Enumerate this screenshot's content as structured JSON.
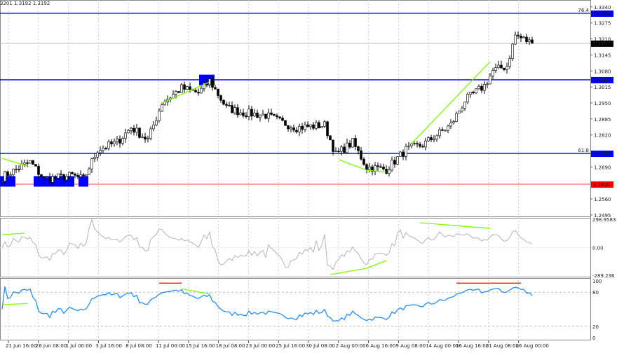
{
  "header": {
    "ohlc_text": "3201 1.3192 1.3192"
  },
  "colors": {
    "up": "#000000",
    "down": "#000000",
    "level_blue": "#0000ff",
    "level_red": "#ff4040",
    "green": "#7cfc00",
    "red": "#ff0000",
    "cci": "#b4b4b4",
    "rsi": "#1e90ff",
    "box": "#0000ff"
  },
  "chart_data": {
    "type": "candlestick",
    "price_axis": {
      "ticks": [
        "1.3340",
        "1.3275",
        "1.3210",
        "1.3145",
        "1.3080",
        "1.3015",
        "1.2950",
        "1.2885",
        "1.2820",
        "1.2690",
        "1.2560",
        "1.2495"
      ],
      "range": [
        1.2495,
        1.334
      ]
    },
    "current_price": {
      "label": "1.3192",
      "value": 1.3192
    },
    "levels": [
      {
        "label": "1.3314",
        "value": 1.3314,
        "color": "blue",
        "fib": "76.4"
      },
      {
        "label": "1.3044",
        "value": 1.3044,
        "color": "blue",
        "fib": ""
      },
      {
        "label": "1.2745",
        "value": 1.2745,
        "color": "blue",
        "fib": "61.8"
      },
      {
        "label": "1.2620",
        "value": 1.262,
        "color": "red",
        "fib": ""
      }
    ],
    "x_labels": [
      "21 Jun 16:00",
      "26 Jun 08:00",
      "1 Jul 00:00",
      "3 Jul 16:00",
      "8 Jul 08:00",
      "11 Jul 00:00",
      "15 Jul 16:00",
      "18 Jul 08:00",
      "23 Jul 00:00",
      "25 Jul 16:00",
      "30 Jul 08:00",
      "2 Aug 00:00",
      "6 Aug 16:00",
      "9 Aug 08:00",
      "14 Aug 00:00",
      "16 Aug 16:00",
      "21 Aug 08:00",
      "26 Aug 00:00"
    ],
    "price_path_bar_close": [
      [
        0,
        1.265
      ],
      [
        10,
        1.271
      ],
      [
        15,
        1.264
      ],
      [
        25,
        1.2655
      ],
      [
        29,
        1.264
      ],
      [
        34,
        1.276
      ],
      [
        41,
        1.279
      ],
      [
        46,
        1.285
      ],
      [
        52,
        1.28
      ],
      [
        57,
        1.295
      ],
      [
        64,
        1.301
      ],
      [
        70,
        1.299
      ],
      [
        74,
        1.304
      ],
      [
        80,
        1.293
      ],
      [
        86,
        1.291
      ],
      [
        94,
        1.29
      ],
      [
        100,
        1.287
      ],
      [
        105,
        1.285
      ],
      [
        115,
        1.286
      ],
      [
        119,
        1.274
      ],
      [
        125,
        1.279
      ],
      [
        130,
        1.269
      ],
      [
        137,
        1.268
      ],
      [
        144,
        1.276
      ],
      [
        150,
        1.278
      ],
      [
        160,
        1.286
      ],
      [
        165,
        1.296
      ],
      [
        172,
        1.302
      ],
      [
        175,
        1.308
      ],
      [
        180,
        1.31
      ],
      [
        183,
        1.3225
      ],
      [
        189,
        1.3192
      ]
    ],
    "boxes": [
      {
        "bars": [
          0,
          4
        ],
        "price": 1.263
      },
      {
        "bars": [
          12,
          25
        ],
        "price": 1.263
      },
      {
        "bars": [
          28,
          30
        ],
        "price": 1.263
      },
      {
        "bars": [
          71,
          75
        ],
        "price": 1.3042
      }
    ],
    "price_trendlines": [
      [
        [
          0,
          1.2725
        ],
        [
          9,
          1.2694
        ]
      ],
      [
        [
          57,
          1.295
        ],
        [
          74,
          1.3035
        ]
      ],
      [
        [
          120,
          1.272
        ],
        [
          130,
          1.2677
        ],
        [
          137,
          1.2669
        ]
      ],
      [
        [
          146,
          1.2785
        ],
        [
          174,
          1.3118
        ]
      ]
    ],
    "cci": {
      "name": "CCI",
      "top_label": "298.9583",
      "zero_label": "0.00",
      "bottom_label": "-289.236",
      "range": [
        -289.236,
        298.9583
      ],
      "trendlines": [
        [
          [
            0,
            137
          ],
          [
            8,
            152
          ]
        ],
        [
          [
            117,
            -282
          ],
          [
            130,
            -216
          ],
          [
            137,
            -135
          ]
        ],
        [
          [
            149,
            262
          ],
          [
            174,
            203
          ]
        ]
      ]
    },
    "rsi": {
      "name": "RSI",
      "labels": [
        "100",
        "80",
        "20",
        "0"
      ],
      "range": [
        0,
        100
      ],
      "levels": [
        80,
        20
      ],
      "green_lines": [
        [
          [
            0,
            58
          ],
          [
            9,
            60
          ]
        ],
        [
          [
            64,
            86
          ],
          [
            74,
            77
          ]
        ]
      ],
      "red_lines": [
        [
          [
            56,
            96
          ],
          [
            64,
            96
          ]
        ],
        [
          [
            162,
            96
          ],
          [
            185,
            96
          ]
        ]
      ]
    }
  }
}
